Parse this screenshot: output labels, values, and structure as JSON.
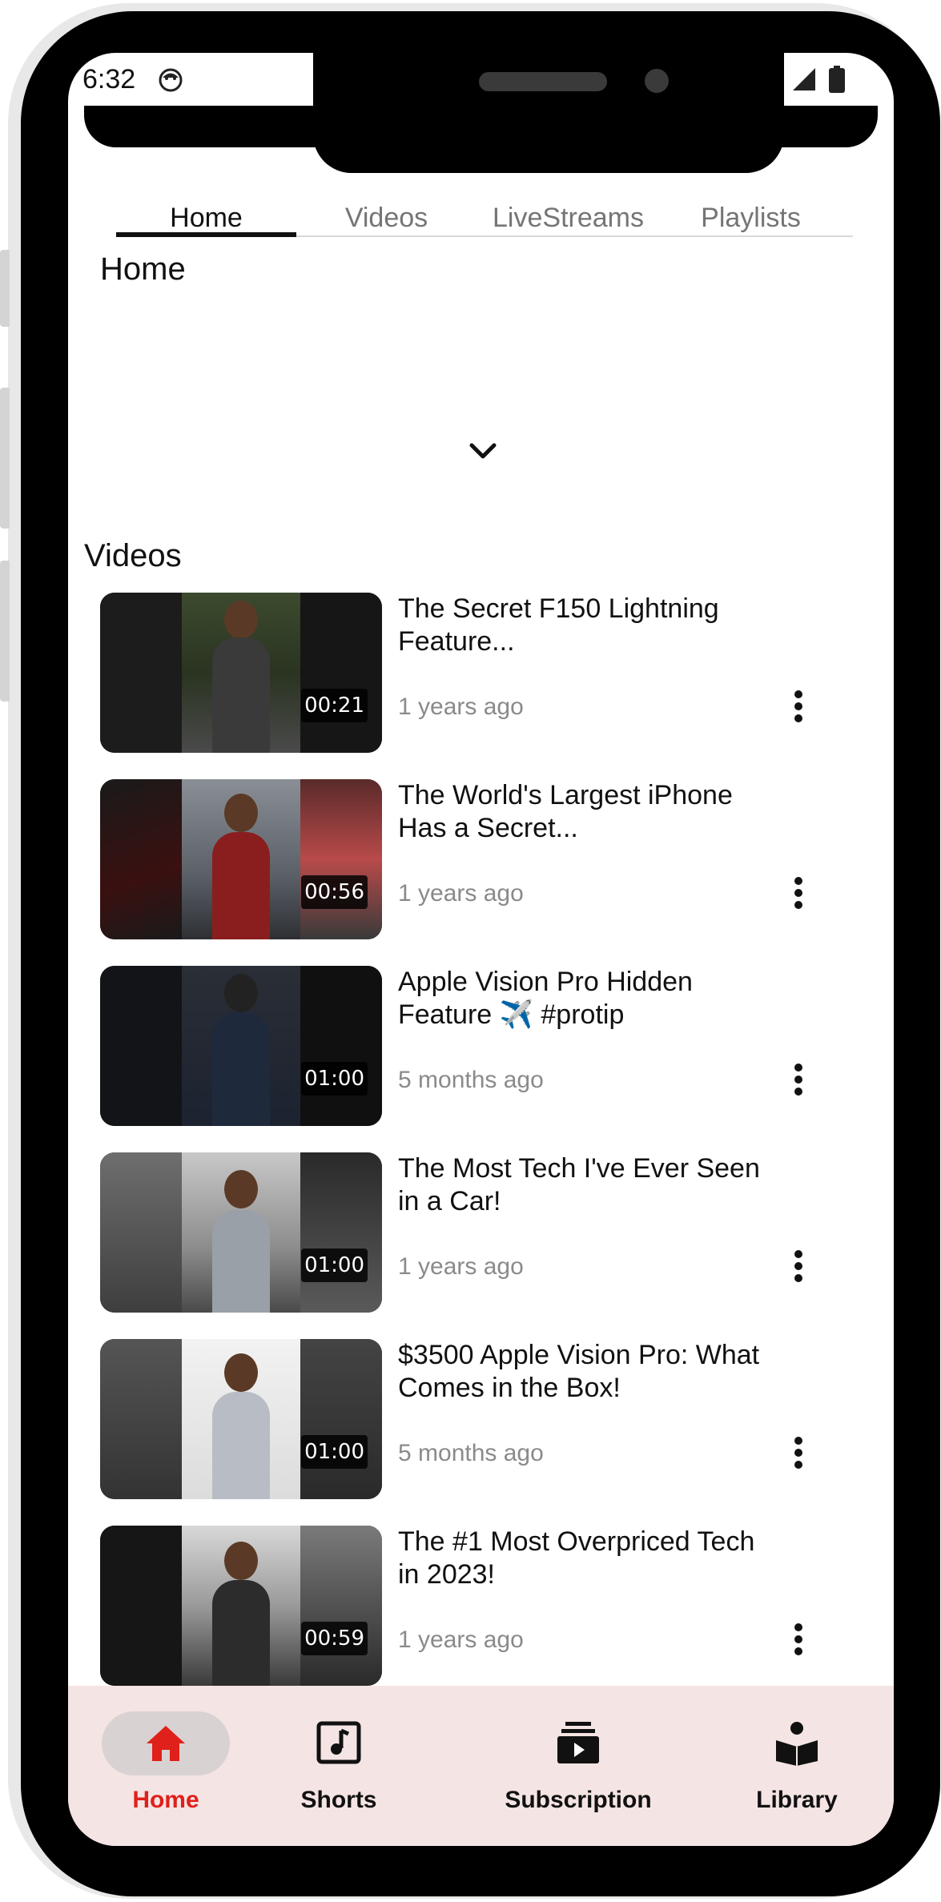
{
  "status_bar": {
    "time": "6:32"
  },
  "tabs": [
    {
      "label": "Home",
      "active": true
    },
    {
      "label": "Videos",
      "active": false
    },
    {
      "label": "LiveStreams",
      "active": false
    },
    {
      "label": "Playlists",
      "active": false
    }
  ],
  "home_section": {
    "title": "Home"
  },
  "videos_section": {
    "title": "Videos",
    "items": [
      {
        "title": "The Secret F150 Lightning Feature...",
        "meta": "1 years ago",
        "duration": "00:21"
      },
      {
        "title": "The World's Largest iPhone Has a Secret...",
        "meta": "1 years ago",
        "duration": "00:56"
      },
      {
        "title": "Apple Vision Pro Hidden Feature ✈️ #protip",
        "meta": "5 months ago",
        "duration": "01:00"
      },
      {
        "title": "The Most Tech I've Ever Seen in a Car!",
        "meta": "1 years ago",
        "duration": "01:00"
      },
      {
        "title": "$3500 Apple Vision Pro: What Comes in the Box!",
        "meta": "5 months ago",
        "duration": "01:00"
      },
      {
        "title": "The #1 Most Overpriced Tech in 2023!",
        "meta": "1 years ago",
        "duration": "00:59"
      }
    ]
  },
  "bottom_nav": {
    "home": "Home",
    "shorts": "Shorts",
    "subscription": "Subscription",
    "library": "Library"
  },
  "colors": {
    "accent": "#e0201a",
    "nav_background": "#f5e4e4",
    "nav_pill": "#d9d2d2"
  }
}
